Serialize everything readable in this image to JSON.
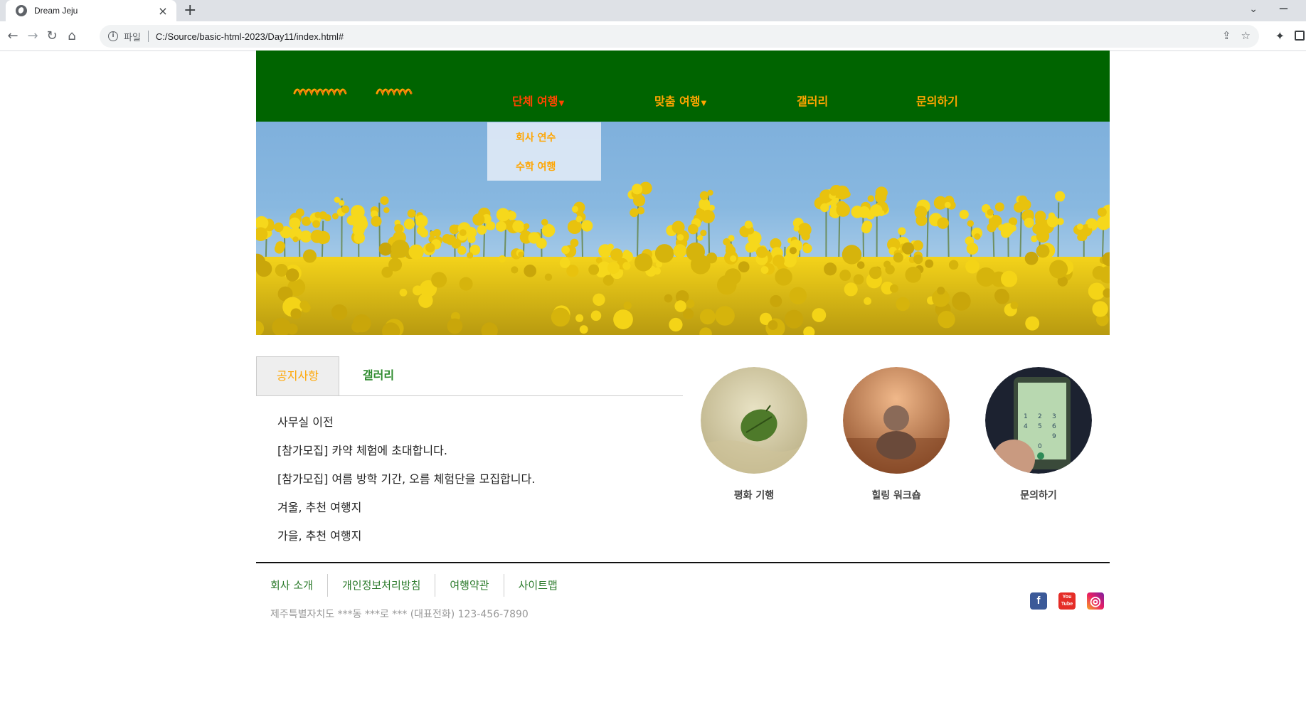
{
  "browser": {
    "tab_title": "Dream Jeju",
    "new_tab": "+",
    "scheme_label": "파일",
    "url": "C:/Source/basic-html-2023/Day11/index.html#"
  },
  "site": {
    "logo_text": "",
    "menu": [
      {
        "label": "단체 여행",
        "has_dropdown": true,
        "state": "active"
      },
      {
        "label": "맞춤 여행",
        "has_dropdown": true
      },
      {
        "label": "갤러리",
        "has_dropdown": false
      },
      {
        "label": "문의하기",
        "has_dropdown": false
      }
    ],
    "dropdown": [
      "회사 연수",
      "수학 여행"
    ],
    "tabs": [
      "공지사항",
      "갤러리"
    ],
    "notices": [
      "사무실 이전",
      "[참가모집] 카약 체험에 초대합니다.",
      "[참가모집] 여름 방학 기간, 오름 체험단을 모집합니다.",
      "겨울, 추천 여행지",
      "가을, 추천 여행지"
    ],
    "features": [
      {
        "label": "평화 기행",
        "icon": "leaf-on-sand"
      },
      {
        "label": "힐링 워크숍",
        "icon": "stacked-stones"
      },
      {
        "label": "문의하기",
        "icon": "phone-dialpad"
      }
    ],
    "footer_links": [
      "회사 소개",
      "개인정보처리방침",
      "여행약관",
      "사이트맵"
    ],
    "address": "제주특별자치도 ***동 ***로 *** (대표전화) 123-456-7890",
    "social": [
      {
        "name": "facebook",
        "glyph": "f",
        "color": "#3b5998"
      },
      {
        "name": "youtube",
        "glyph": "You\nTube",
        "color": "#e52d27"
      },
      {
        "name": "instagram",
        "glyph": "◎",
        "color": "#c13584"
      }
    ],
    "colors": {
      "header": "#006400",
      "menu": "#ffa500",
      "menu_active": "#ff4500",
      "footer_link": "#2a7a2a"
    }
  }
}
